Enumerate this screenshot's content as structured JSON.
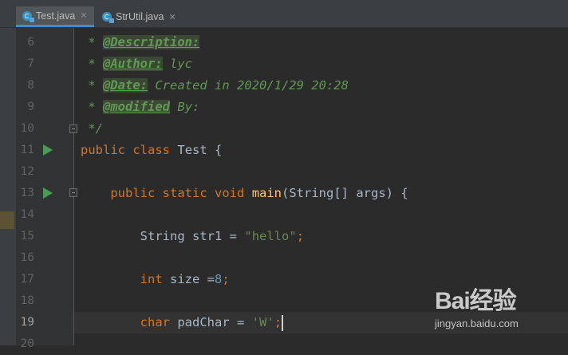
{
  "tabs": [
    {
      "label": "Test.java",
      "icon": "java-class-icon",
      "active": true
    },
    {
      "label": "StrUtil.java",
      "icon": "java-class-icon",
      "active": false
    }
  ],
  "close_glyph": "✕",
  "gutter": {
    "line_numbers": [
      "6",
      "7",
      "8",
      "9",
      "10",
      "11",
      "12",
      "13",
      "14",
      "15",
      "16",
      "17",
      "18",
      "19",
      "20"
    ],
    "current_line": "19"
  },
  "code": {
    "line6": {
      "prefix": " * ",
      "tag": "@Description:"
    },
    "line7": {
      "prefix": " * ",
      "tag": "@Author:",
      "text": " lyc"
    },
    "line8": {
      "prefix": " * ",
      "tag": "@Date:",
      "text": " Created in 2020/1/29 20:28"
    },
    "line9": {
      "prefix": " * ",
      "tag": "@modified",
      "text": " By:"
    },
    "line10": {
      "text": " */"
    },
    "line11": {
      "kw1": "public",
      "kw2": "class",
      "name": "Test",
      "brace": "{"
    },
    "line13": {
      "kw1": "public",
      "kw2": "static",
      "kw3": "void",
      "method": "main",
      "params": "(String[] args) {"
    },
    "line15": {
      "type": "String",
      "var": "str1",
      "eq": "=",
      "value": "\"hello\"",
      "semi": ";"
    },
    "line17": {
      "type": "int",
      "var": "size",
      "eq": "=",
      "value": "8",
      "semi": ";"
    },
    "line19": {
      "type": "char",
      "var": "padChar",
      "eq": "=",
      "value": "'W'",
      "semi": ";"
    }
  },
  "watermark": {
    "logo": "Bai经验",
    "url": "jingyan.baidu.com"
  },
  "colors": {
    "background": "#2b2b2b",
    "gutter": "#313335",
    "keyword": "#cc7832",
    "string": "#6a8759",
    "number": "#6897bb",
    "doc_comment": "#629755",
    "method": "#ffc66d",
    "run_icon": "#499c54"
  }
}
